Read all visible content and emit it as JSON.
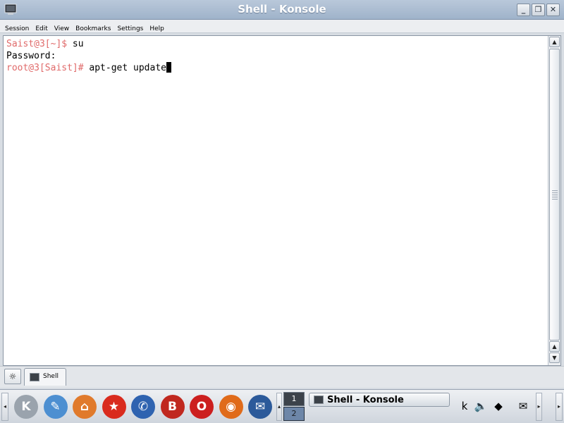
{
  "window": {
    "title": "Shell - Konsole",
    "buttons": {
      "minimize": "_",
      "maximize": "❐",
      "close": "✕"
    }
  },
  "menubar": {
    "items": [
      "Session",
      "Edit",
      "View",
      "Bookmarks",
      "Settings",
      "Help"
    ]
  },
  "terminal": {
    "lines": [
      {
        "prompt": "Saist@3[~]$",
        "command": " su"
      },
      {
        "prompt": "",
        "command": "Password:"
      },
      {
        "prompt": "root@3[Saist]#",
        "command": " apt-get update"
      }
    ],
    "prompt_color": "#e06a6a"
  },
  "tabs": {
    "session_tab_label": "Shell"
  },
  "panel": {
    "launchers": [
      {
        "name": "kde-menu-icon",
        "glyph": "K",
        "color": "#9aa3ad"
      },
      {
        "name": "kwrite-icon",
        "glyph": "✎",
        "color": "#4d8fd1"
      },
      {
        "name": "home-icon",
        "glyph": "⌂",
        "color": "#e07a2c"
      },
      {
        "name": "star-app-icon",
        "glyph": "★",
        "color": "#d92b1e"
      },
      {
        "name": "aim-icon",
        "glyph": "✆",
        "color": "#2f63b0"
      },
      {
        "name": "kdict-icon",
        "glyph": "B",
        "color": "#c0281f"
      },
      {
        "name": "opera-icon",
        "glyph": "O",
        "color": "#cc1f1f"
      },
      {
        "name": "firefox-icon",
        "glyph": "◉",
        "color": "#e06b1a"
      },
      {
        "name": "thunderbird-icon",
        "glyph": "✉",
        "color": "#2c5a9a"
      }
    ],
    "pager": {
      "desktop1": "1",
      "desktop2": "2"
    },
    "task_label": "Shell - Konsole",
    "tray": [
      {
        "name": "klipper-icon",
        "glyph": "k"
      },
      {
        "name": "volume-icon",
        "glyph": "🔈"
      },
      {
        "name": "network-icon",
        "glyph": "◆"
      },
      {
        "name": "kmail-icon",
        "glyph": "✉"
      }
    ]
  }
}
